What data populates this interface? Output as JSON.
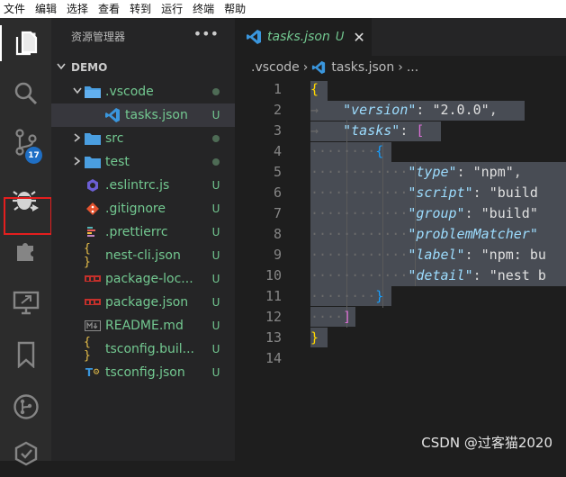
{
  "menu": [
    "文件",
    "编辑",
    "选择",
    "查看",
    "转到",
    "运行",
    "终端",
    "帮助"
  ],
  "activity_bar": {
    "items": [
      "explorer-icon",
      "search-icon",
      "source-control-icon",
      "run-debug-icon",
      "extensions-icon",
      "remote-explorer-icon",
      "bookmarks-icon",
      "git-graph-icon",
      "testing-icon"
    ],
    "source_control_badge": "17",
    "highlight_color": "#e41e1e"
  },
  "sidebar": {
    "title": "资源管理器",
    "more": "•••",
    "section": "DEMO",
    "tree": [
      {
        "label": ".vscode",
        "type": "folder-open",
        "status": "dot",
        "color": "#73c991"
      },
      {
        "label": "tasks.json",
        "type": "vscode-json",
        "status": "U",
        "color": "#73c991",
        "selected": true
      },
      {
        "label": "src",
        "type": "folder",
        "status": "dot",
        "color": "#73c991"
      },
      {
        "label": "test",
        "type": "folder",
        "status": "dot",
        "color": "#73c991"
      },
      {
        "label": ".eslintrc.js",
        "type": "eslint",
        "status": "U",
        "color": "#73c991"
      },
      {
        "label": ".gitignore",
        "type": "git",
        "status": "U",
        "color": "#73c991"
      },
      {
        "label": ".prettierrc",
        "type": "prettier",
        "status": "U",
        "color": "#73c991"
      },
      {
        "label": "nest-cli.json",
        "type": "json",
        "status": "U",
        "color": "#73c991"
      },
      {
        "label": "package-loc...",
        "type": "npm",
        "status": "U",
        "color": "#73c991"
      },
      {
        "label": "package.json",
        "type": "npm",
        "status": "U",
        "color": "#73c991"
      },
      {
        "label": "README.md",
        "type": "markdown",
        "status": "U",
        "color": "#73c991"
      },
      {
        "label": "tsconfig.buil...",
        "type": "json",
        "status": "U",
        "color": "#73c991"
      },
      {
        "label": "tsconfig.json",
        "type": "ts-config",
        "status": "U",
        "color": "#73c991"
      }
    ]
  },
  "tab": {
    "label": "tasks.json",
    "status": "U",
    "close": "✕"
  },
  "breadcrumb": {
    "folder": ".vscode",
    "sep1": "›",
    "file": "tasks.json",
    "sep2": "›",
    "more": "..."
  },
  "editor": {
    "line_numbers": [
      "1",
      "2",
      "3",
      "4",
      "5",
      "6",
      "7",
      "8",
      "9",
      "10",
      "11",
      "12",
      "13",
      "14"
    ],
    "code": {
      "l1": "{",
      "l2_key": "\"version\"",
      "l2_colon": ": ",
      "l2_val": "\"2.0.0\"",
      "l2_comma": ",",
      "l3_key": "\"tasks\"",
      "l3_colon": ": ",
      "l3_br": "[",
      "l4": "{",
      "l5_key": "\"type\"",
      "l5_colon": ": ",
      "l5_val": "\"npm\"",
      "l5_comma": ",",
      "l6_key": "\"script\"",
      "l6_colon": ": ",
      "l6_val": "\"build",
      "l7_key": "\"group\"",
      "l7_colon": ": ",
      "l7_val": "\"build\"",
      "l8_key": "\"problemMatcher\"",
      "l9_key": "\"label\"",
      "l9_colon": ": ",
      "l9_val": "\"npm: bu",
      "l10_key": "\"detail\"",
      "l10_colon": ": ",
      "l10_val": "\"nest b",
      "l11": "}",
      "l12": "]",
      "l13": "}"
    }
  },
  "watermark": "CSDN @过客猫2020"
}
